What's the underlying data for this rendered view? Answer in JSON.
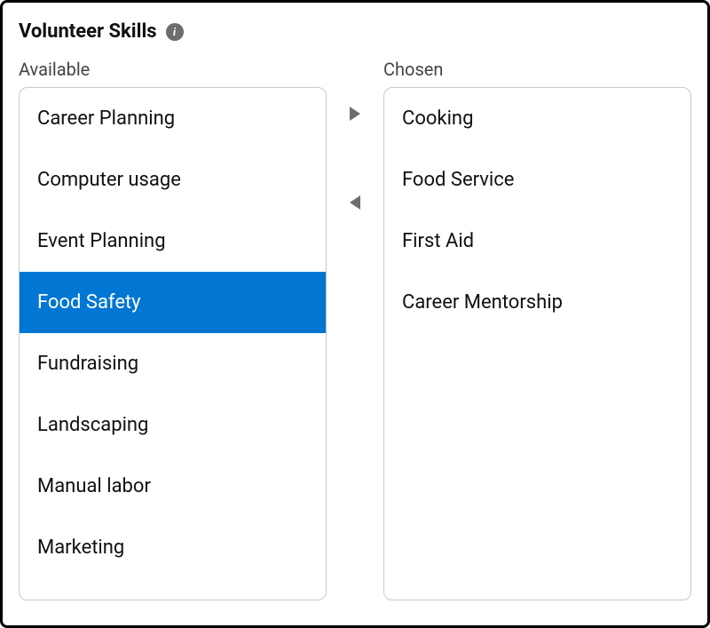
{
  "title": "Volunteer Skills",
  "info_tooltip": "i",
  "columns": {
    "available_label": "Available",
    "chosen_label": "Chosen"
  },
  "available": {
    "items": [
      {
        "label": "Career Planning",
        "selected": false
      },
      {
        "label": "Computer usage",
        "selected": false
      },
      {
        "label": "Event Planning",
        "selected": false
      },
      {
        "label": "Food Safety",
        "selected": true
      },
      {
        "label": "Fundraising",
        "selected": false
      },
      {
        "label": "Landscaping",
        "selected": false
      },
      {
        "label": "Manual labor",
        "selected": false
      },
      {
        "label": "Marketing",
        "selected": false
      }
    ]
  },
  "chosen": {
    "items": [
      {
        "label": "Cooking",
        "selected": false
      },
      {
        "label": "Food Service",
        "selected": false
      },
      {
        "label": "First Aid",
        "selected": false
      },
      {
        "label": "Career Mentorship",
        "selected": false
      }
    ]
  },
  "colors": {
    "selected_bg": "#0176d3",
    "arrow": "#6d6d6d"
  }
}
